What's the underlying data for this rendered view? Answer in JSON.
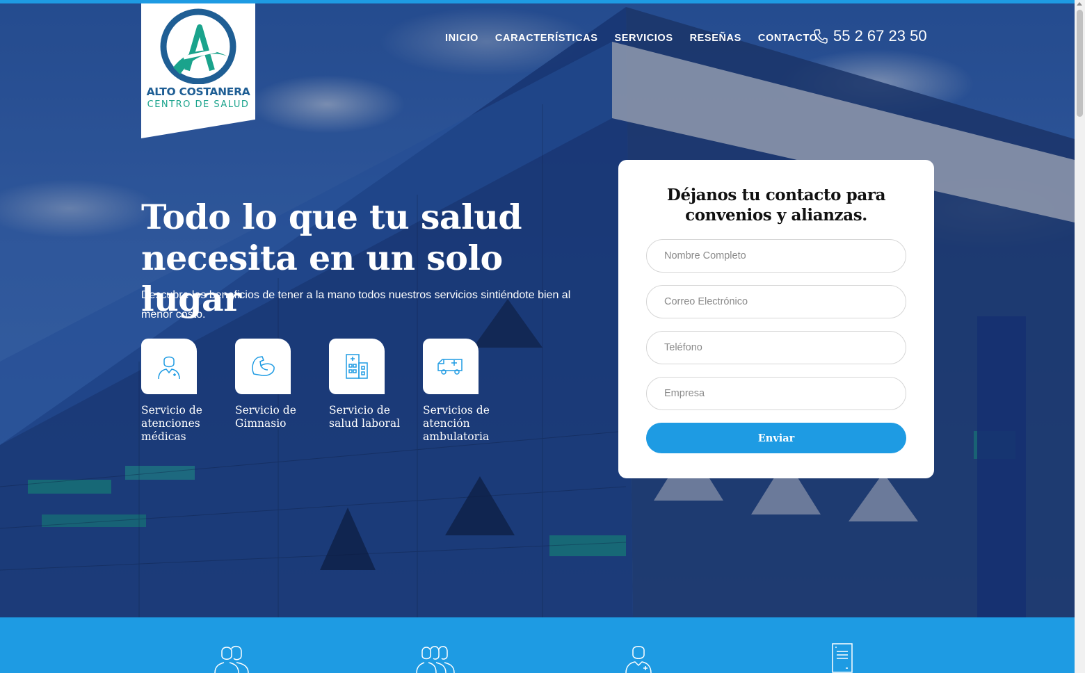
{
  "brand": {
    "name": "ALTO COSTANERA",
    "tagline": "CENTRO DE SALUD",
    "colors": {
      "primary": "#1e9be3",
      "logo_blue": "#1f5e94",
      "logo_teal": "#1aa38c"
    }
  },
  "nav": {
    "items": [
      {
        "label": "INICIO"
      },
      {
        "label": "CARACTERÍSTICAS"
      },
      {
        "label": "SERVICIOS"
      },
      {
        "label": "RESEÑAS"
      },
      {
        "label": "CONTACTO"
      }
    ]
  },
  "header": {
    "phone_icon": "phone-icon",
    "phone": "55 2 67 23 50"
  },
  "hero": {
    "headline": "Todo lo que tu salud necesita en un solo lugar",
    "subtext": "Descubre los beneficios de tener a la mano todos nuestros servicios sintiéndote bien al menor costo.",
    "services": [
      {
        "icon": "doctor-icon",
        "label": "Servicio de atenciones médicas"
      },
      {
        "icon": "muscle-icon",
        "label": "Servicio de Gimnasio"
      },
      {
        "icon": "hospital-icon",
        "label": "Servicio de salud laboral"
      },
      {
        "icon": "ambulance-icon",
        "label": "Servicios de atención ambulatoria"
      }
    ]
  },
  "form": {
    "title": "Déjanos tu contacto para convenios y alianzas.",
    "fields": [
      {
        "placeholder": "Nombre Completo",
        "value": ""
      },
      {
        "placeholder": "Correo Electrónico",
        "value": ""
      },
      {
        "placeholder": "Teléfono",
        "value": ""
      },
      {
        "placeholder": "Empresa",
        "value": ""
      }
    ],
    "submit_label": "Enviar"
  },
  "features_band": {
    "icons": [
      "users-icon",
      "group-icon",
      "doctor-icon",
      "document-icon"
    ]
  }
}
